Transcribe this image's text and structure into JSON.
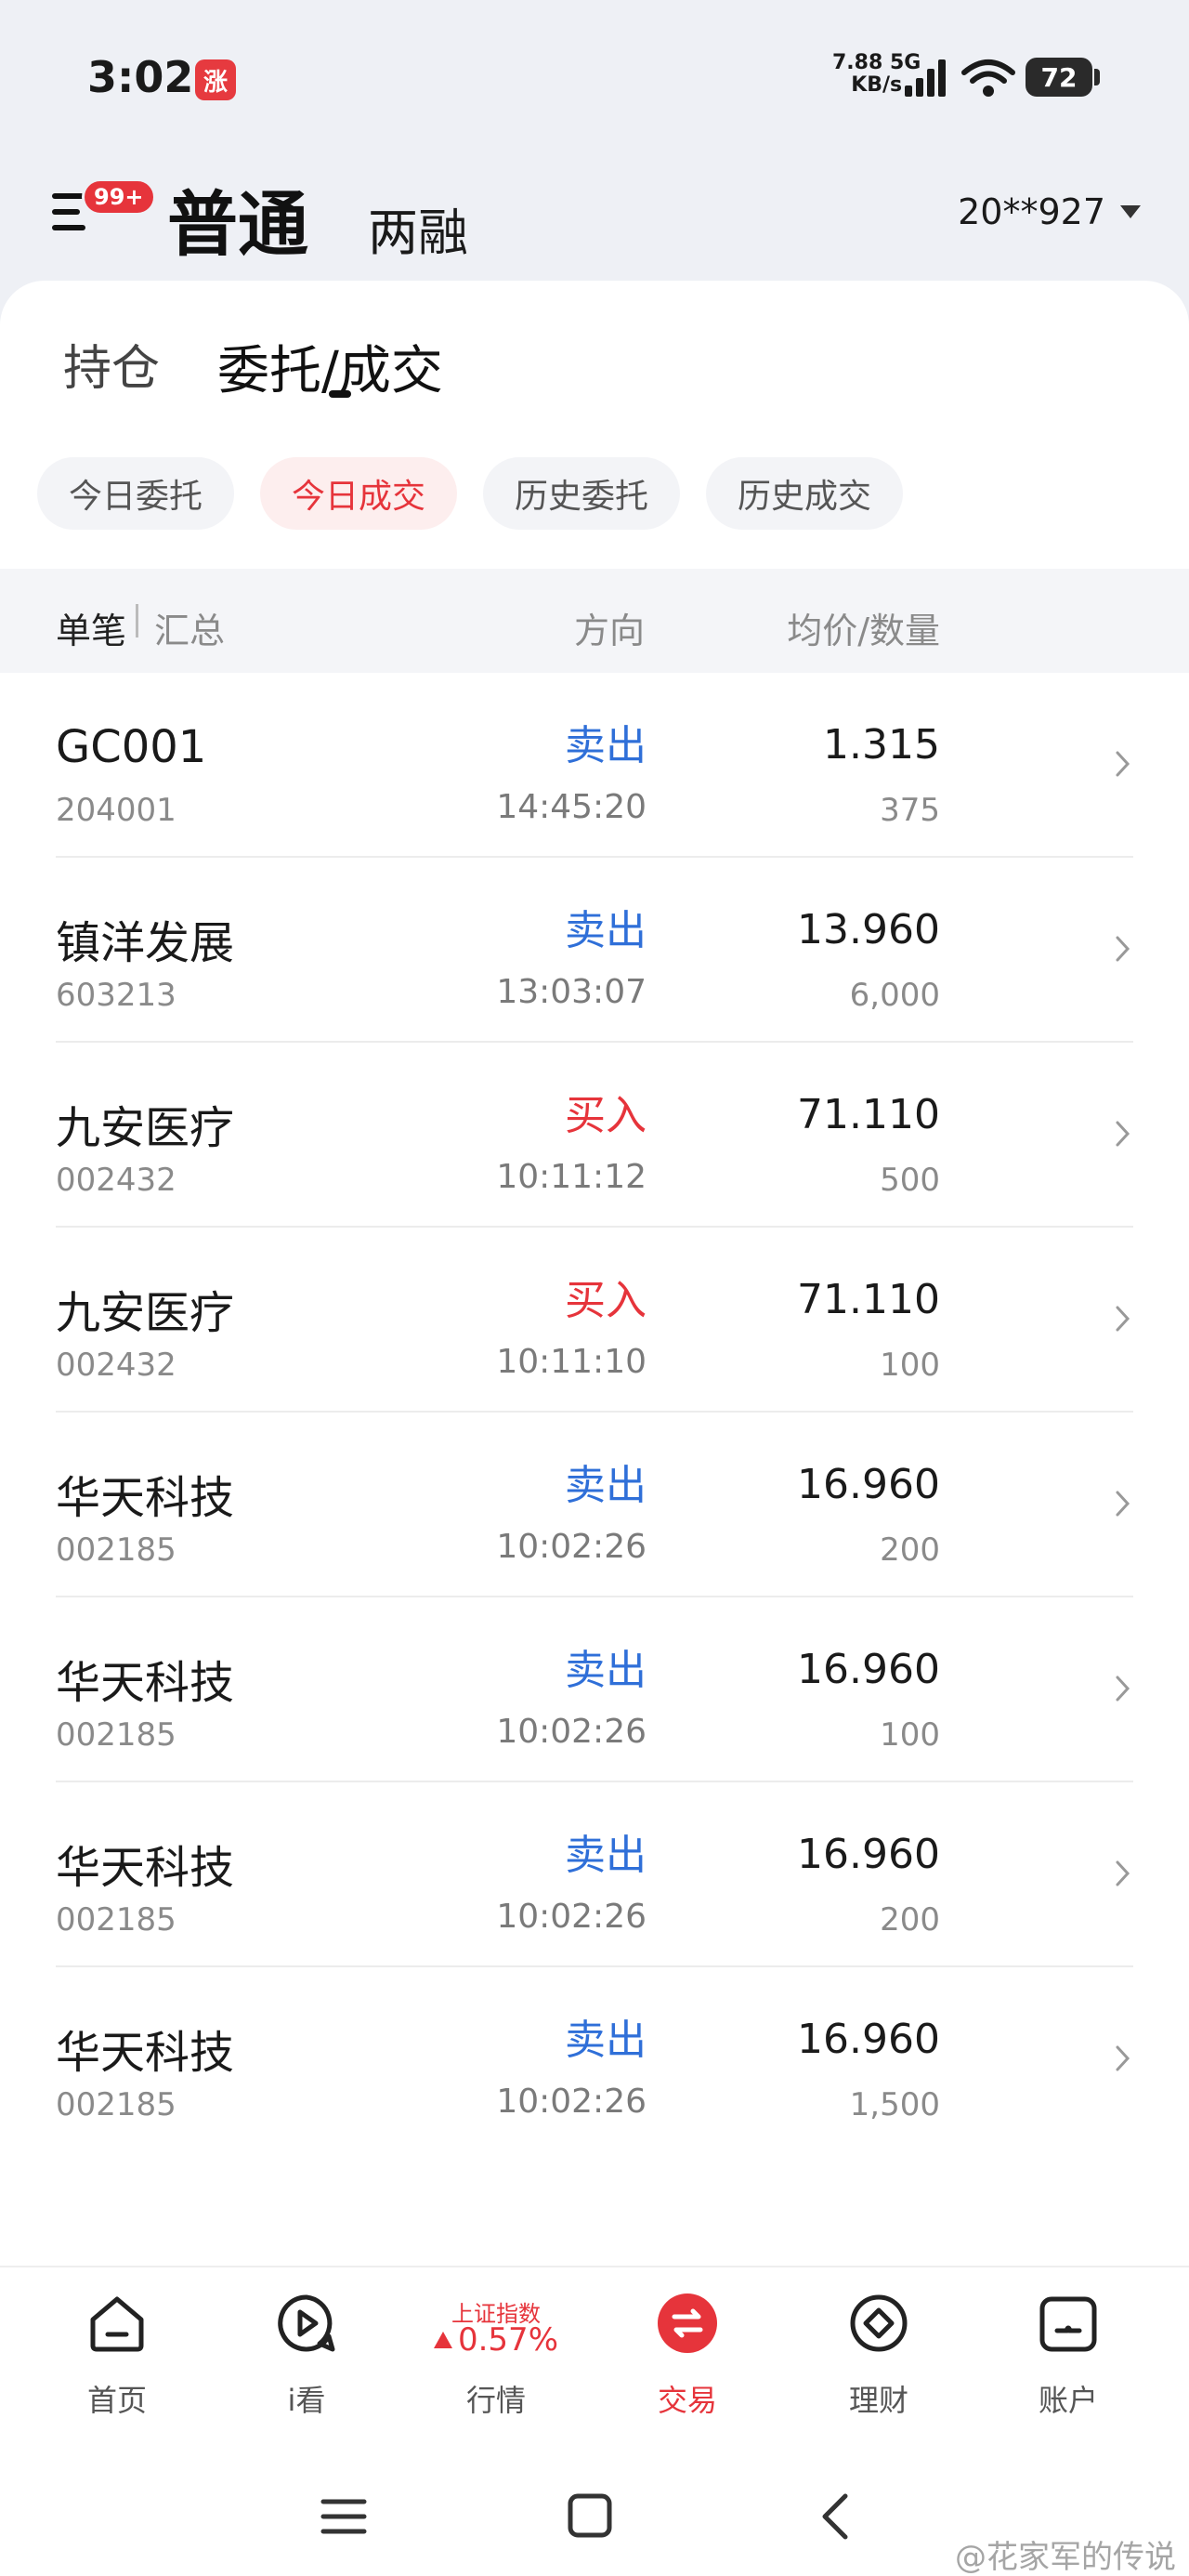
{
  "status_bar": {
    "time": "3:02",
    "app_badge": "涨",
    "net_speed_value": "7.88",
    "net_speed_unit": "KB/s",
    "network": "5G",
    "battery": "72"
  },
  "header": {
    "menu_badge": "99+",
    "mode_normal": "普通",
    "mode_margin": "两融",
    "account": "20**927"
  },
  "tabs": {
    "holdings": "持仓",
    "orders": "委托",
    "separator": "/",
    "trades": "成交"
  },
  "filters": [
    {
      "label": "今日委托",
      "active": false
    },
    {
      "label": "今日成交",
      "active": true
    },
    {
      "label": "历史委托",
      "active": false
    },
    {
      "label": "历史成交",
      "active": false
    }
  ],
  "table_header": {
    "single": "单笔",
    "summary": "汇总",
    "direction": "方向",
    "price_qty": "均价/数量"
  },
  "trades": [
    {
      "name": "GC001",
      "code": "204001",
      "direction": "卖出",
      "side": "sell",
      "time": "14:45:20",
      "price": "1.315",
      "quantity": "375"
    },
    {
      "name": "镇洋发展",
      "code": "603213",
      "direction": "卖出",
      "side": "sell",
      "time": "13:03:07",
      "price": "13.960",
      "quantity": "6,000"
    },
    {
      "name": "九安医疗",
      "code": "002432",
      "direction": "买入",
      "side": "buy",
      "time": "10:11:12",
      "price": "71.110",
      "quantity": "500"
    },
    {
      "name": "九安医疗",
      "code": "002432",
      "direction": "买入",
      "side": "buy",
      "time": "10:11:10",
      "price": "71.110",
      "quantity": "100"
    },
    {
      "name": "华天科技",
      "code": "002185",
      "direction": "卖出",
      "side": "sell",
      "time": "10:02:26",
      "price": "16.960",
      "quantity": "200"
    },
    {
      "name": "华天科技",
      "code": "002185",
      "direction": "卖出",
      "side": "sell",
      "time": "10:02:26",
      "price": "16.960",
      "quantity": "100"
    },
    {
      "name": "华天科技",
      "code": "002185",
      "direction": "卖出",
      "side": "sell",
      "time": "10:02:26",
      "price": "16.960",
      "quantity": "200"
    },
    {
      "name": "华天科技",
      "code": "002185",
      "direction": "卖出",
      "side": "sell",
      "time": "10:02:26",
      "price": "16.960",
      "quantity": "1,500"
    }
  ],
  "bottom_nav": {
    "home": "首页",
    "watch": "i看",
    "market_index_name": "上证指数",
    "market_index_change": "0.57%",
    "market": "行情",
    "trade": "交易",
    "wealth": "理财",
    "account": "账户"
  },
  "watermark": "@花家军的传说",
  "colors": {
    "sell": "#2f6fd8",
    "buy": "#e6343b",
    "accent": "#e6343b"
  }
}
